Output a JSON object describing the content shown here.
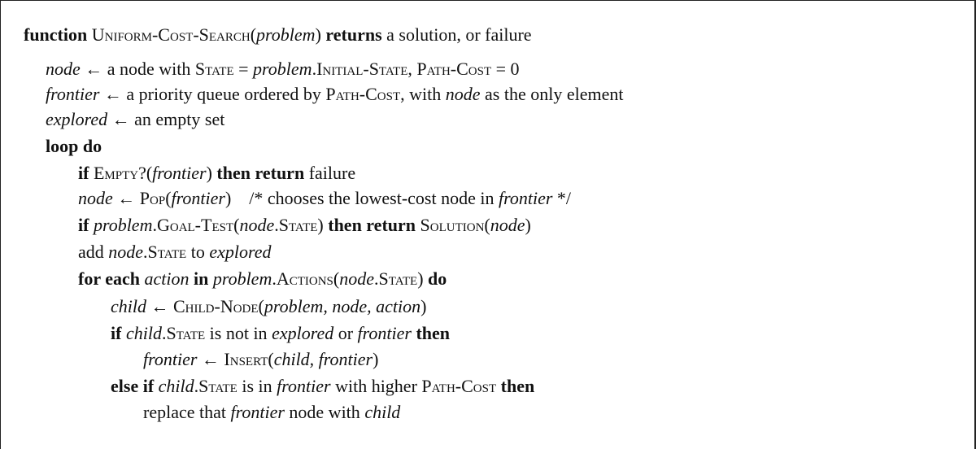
{
  "algorithm": {
    "header": {
      "kw_function": "function",
      "name": "Uniform-Cost-Search",
      "open": "(",
      "arg": "problem",
      "close": ")",
      "kw_returns": "returns",
      "rest": "a solution, or failure"
    },
    "line1": {
      "v_node": "node",
      "arrow": " ← a node with ",
      "state": "State",
      "eq": " = ",
      "problem": "problem",
      "dot": ".",
      "init": "Initial-State",
      "comma": ", ",
      "pathcost": "Path-Cost",
      "eq0": " = 0"
    },
    "line2": {
      "v_frontier": "frontier",
      "arrow": " ← a priority queue ordered by ",
      "pathcost": "Path-Cost",
      "with": ", with ",
      "node": "node",
      "rest": " as the only element"
    },
    "line3": {
      "v_explored": "explored",
      "rest": " ← an empty set"
    },
    "line4": {
      "kw": "loop do"
    },
    "line5": {
      "kw_if": "if",
      "empty": "Empty?",
      "open": "(",
      "frontier": "frontier",
      "close": ")",
      "kw_then_return": "then return",
      "rest": "failure"
    },
    "line6": {
      "node": "node",
      "arrow": " ← ",
      "pop": "Pop",
      "open": "(",
      "frontier": "frontier",
      "close": ")",
      "comment1": "/* chooses the lowest-cost node in ",
      "comment_frontier": "frontier",
      "comment2": " */"
    },
    "line7": {
      "kw_if": "if",
      "problem": "problem",
      "dot": ".",
      "goaltest": "Goal-Test",
      "open": "(",
      "node": "node",
      "dot2": ".",
      "state": "State",
      "close": ")",
      "kw_then_return": "then return",
      "solution": "Solution",
      "open2": "(",
      "node2": "node",
      "close2": ")"
    },
    "line8": {
      "add": "add ",
      "node": "node",
      "dot": ".",
      "state": "State",
      "to": " to ",
      "explored": "explored"
    },
    "line9": {
      "kw_for_each": "for each",
      "action": "action",
      "kw_in": "in",
      "problem": "problem",
      "dot": ".",
      "actions": "Actions",
      "open": "(",
      "node": "node",
      "dot2": ".",
      "state": "State",
      "close": ")",
      "kw_do": "do"
    },
    "line10": {
      "child": "child",
      "arrow": " ← ",
      "childnode": "Child-Node",
      "open": "(",
      "args": "problem, node, action",
      "close": ")"
    },
    "line11": {
      "kw_if": "if",
      "child": "child",
      "dot": ".",
      "state": "State",
      "mid": " is not in ",
      "explored": "explored",
      "or": " or ",
      "frontier": "frontier",
      "kw_then": "then"
    },
    "line12": {
      "frontier": "frontier",
      "arrow": " ← ",
      "insert": "Insert",
      "open": "(",
      "args": "child, frontier",
      "close": ")"
    },
    "line13": {
      "kw_else_if": "else if",
      "child": "child",
      "dot": ".",
      "state": "State",
      "mid": " is in ",
      "frontier": "frontier",
      "with": " with higher ",
      "pathcost": "Path-Cost",
      "kw_then": "then"
    },
    "line14": {
      "replace": "replace that ",
      "frontier": "frontier",
      "mid": " node with ",
      "child": "child"
    }
  }
}
